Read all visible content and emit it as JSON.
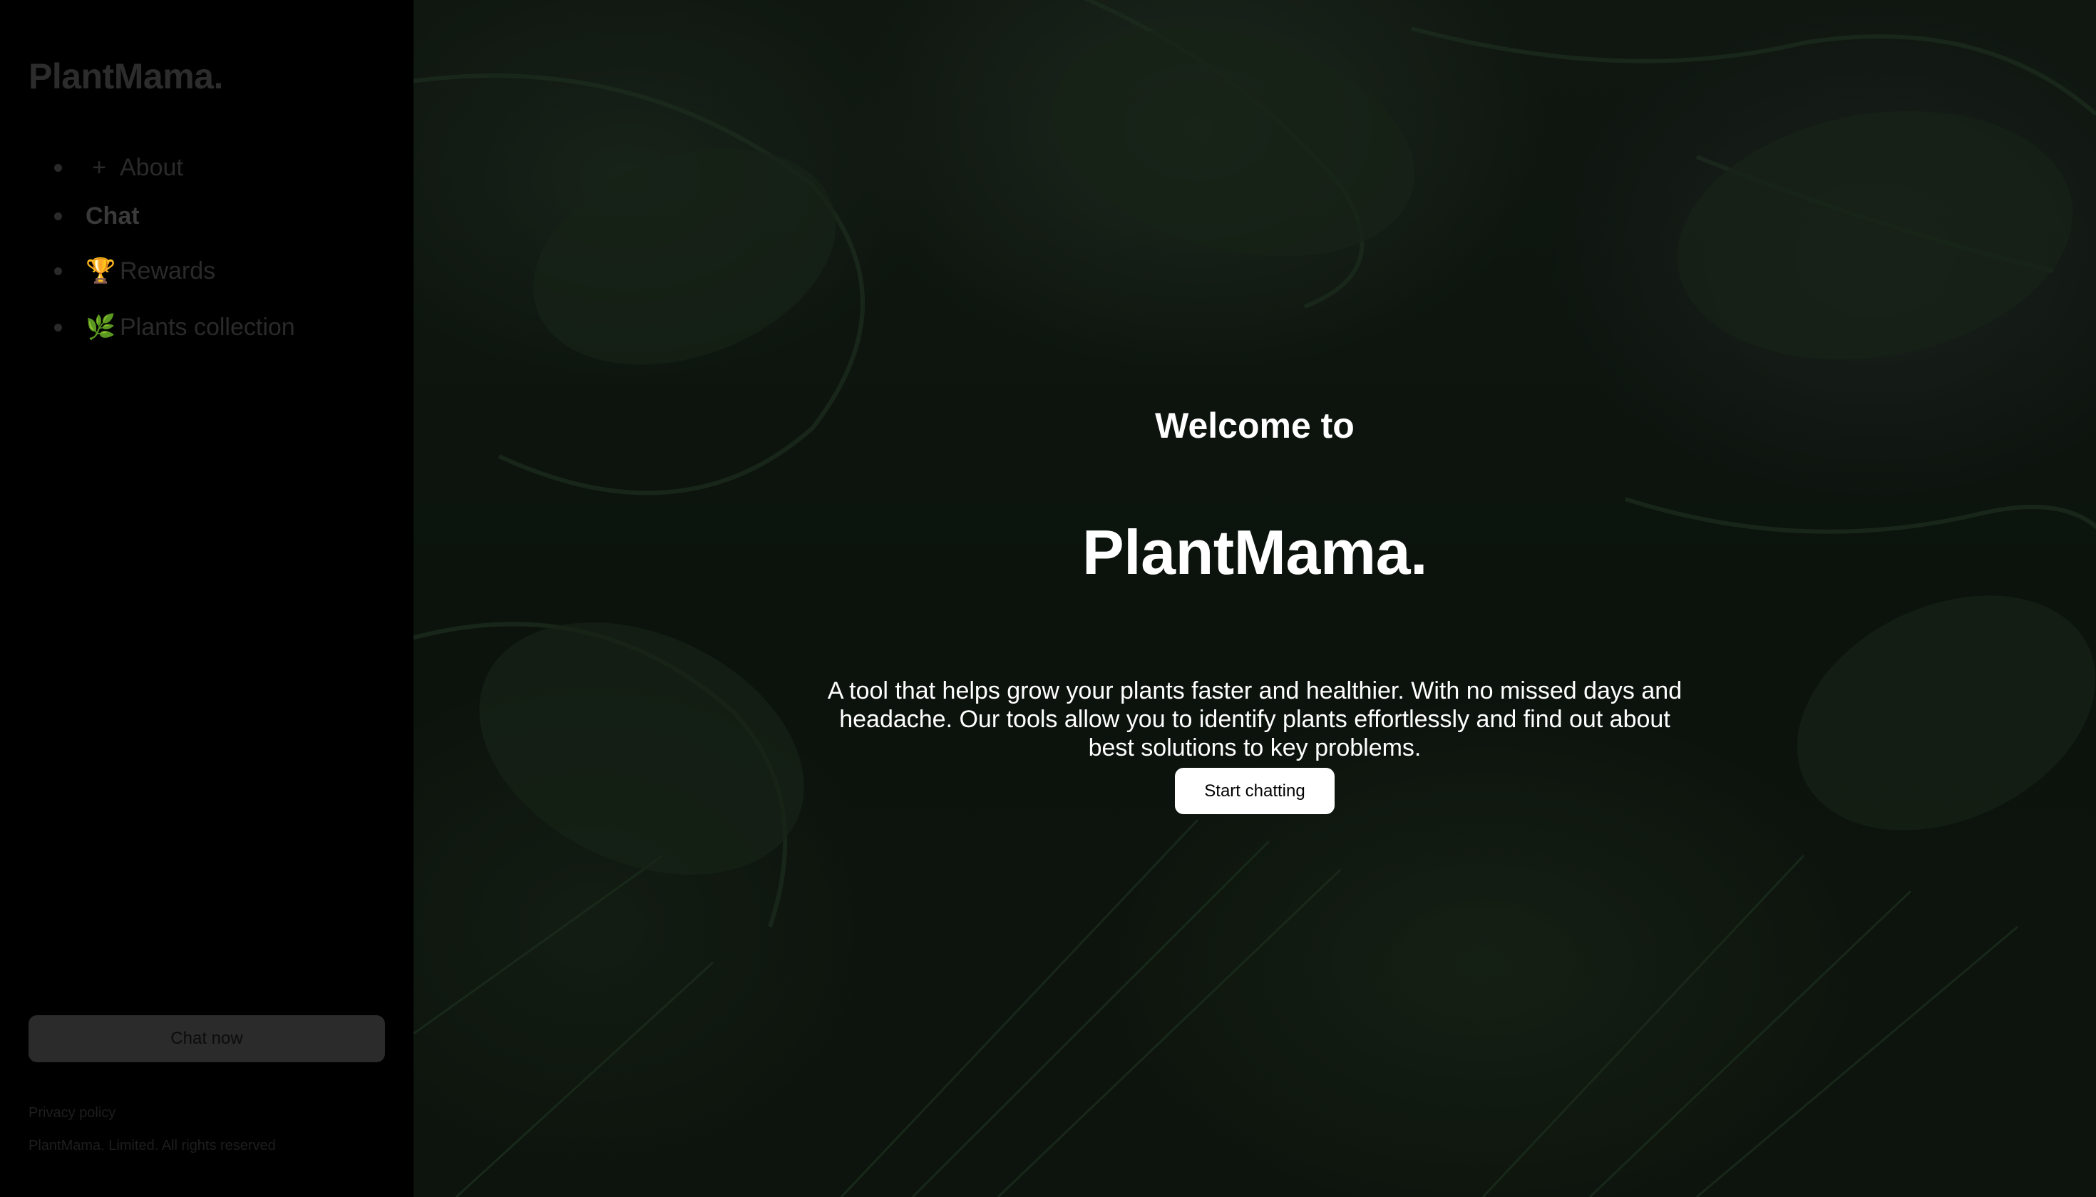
{
  "sidebar": {
    "brand": "PlantMama.",
    "nav": [
      {
        "icon": "plus-icon",
        "glyph": "+",
        "label": "About"
      },
      {
        "label": "Chat"
      },
      {
        "icon": "trophy-icon",
        "glyph": "🏆",
        "label": "Rewards"
      },
      {
        "icon": "herb-icon",
        "glyph": "🌿",
        "label": "Plants collection"
      }
    ],
    "chat_now": "Chat now",
    "privacy": "Privacy policy",
    "copyright": "PlantMama. Limited. All rights reserved"
  },
  "hero": {
    "welcome": "Welcome to",
    "title": "PlantMama.",
    "description": "A tool that helps grow your plants faster and healthier. With no missed days and headache. Our tools allow you to identify plants effortlessly and find out about best solutions to key problems.",
    "cta": "Start chatting"
  },
  "colors": {
    "sidebar_bg": "#000000",
    "hero_text": "#ffffff",
    "button_bg": "#ffffff"
  }
}
